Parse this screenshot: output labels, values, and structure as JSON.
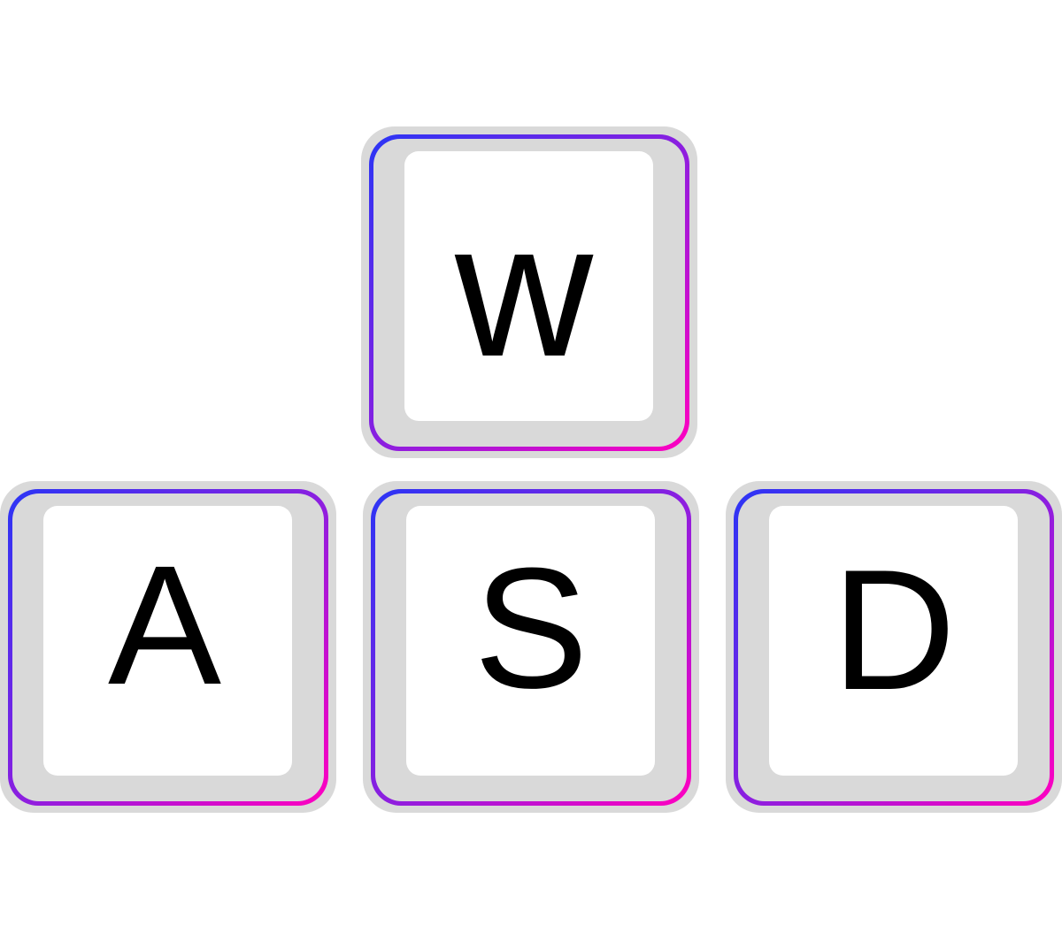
{
  "keys": [
    {
      "id": "w",
      "label": "w"
    },
    {
      "id": "a",
      "label": "A"
    },
    {
      "id": "s",
      "label": "S"
    },
    {
      "id": "d",
      "label": "D"
    }
  ],
  "colors": {
    "gradient_start": "#2b35f5",
    "gradient_end": "#ff00c0",
    "keycap": "#d9d9d9",
    "face": "#ffffff"
  }
}
